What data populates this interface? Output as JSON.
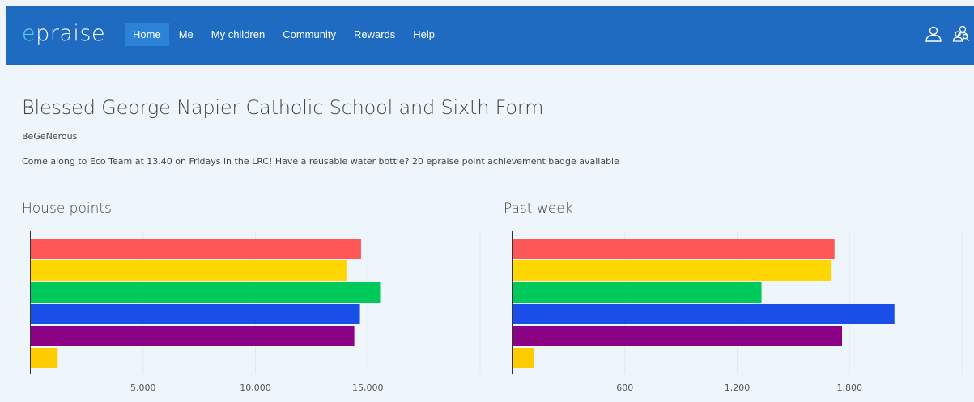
{
  "header": {
    "brand_prefix": "e",
    "brand_rest": "praise",
    "nav": [
      {
        "label": "Home",
        "active": true
      },
      {
        "label": "Me",
        "active": false
      },
      {
        "label": "My children",
        "active": false
      },
      {
        "label": "Community",
        "active": false
      },
      {
        "label": "Rewards",
        "active": false
      },
      {
        "label": "Help",
        "active": false
      }
    ],
    "icons": [
      "user-icon",
      "group-icon"
    ]
  },
  "main": {
    "school_name": "Blessed George Napier Catholic School and Sixth Form",
    "motto": "BeGeNerous",
    "notice": "Come along to Eco Team at 13.40 on Fridays in the LRC! Have a reusable water bottle? 20 epraise point achievement badge available"
  },
  "colors": {
    "red": "#ff5757",
    "yellow": "#ffd600",
    "green": "#00c95c",
    "blue": "#1a4ee8",
    "purple": "#8b0285",
    "gold": "#ffcc00"
  },
  "chart_data": [
    {
      "type": "bar",
      "orientation": "horizontal",
      "title": "House points",
      "values": [
        14700,
        14050,
        15550,
        14650,
        14400,
        1200
      ],
      "bar_colors": [
        "#ff5757",
        "#ffd600",
        "#00c95c",
        "#1a4ee8",
        "#8b0285",
        "#ffcc00"
      ],
      "xlim": [
        0,
        20000
      ],
      "x_ticks": [
        5000,
        10000,
        15000
      ],
      "x_tick_labels": [
        "5,000",
        "10,000",
        "15,000"
      ],
      "grid": true
    },
    {
      "type": "bar",
      "orientation": "horizontal",
      "title": "Past week",
      "values": [
        1720,
        1700,
        1330,
        2040,
        1760,
        115
      ],
      "bar_colors": [
        "#ff5757",
        "#ffd600",
        "#00c95c",
        "#1a4ee8",
        "#8b0285",
        "#ffcc00"
      ],
      "xlim": [
        0,
        2400
      ],
      "x_ticks": [
        600,
        1200,
        1800
      ],
      "x_tick_labels": [
        "600",
        "1,200",
        "1,800"
      ],
      "grid": true
    }
  ]
}
